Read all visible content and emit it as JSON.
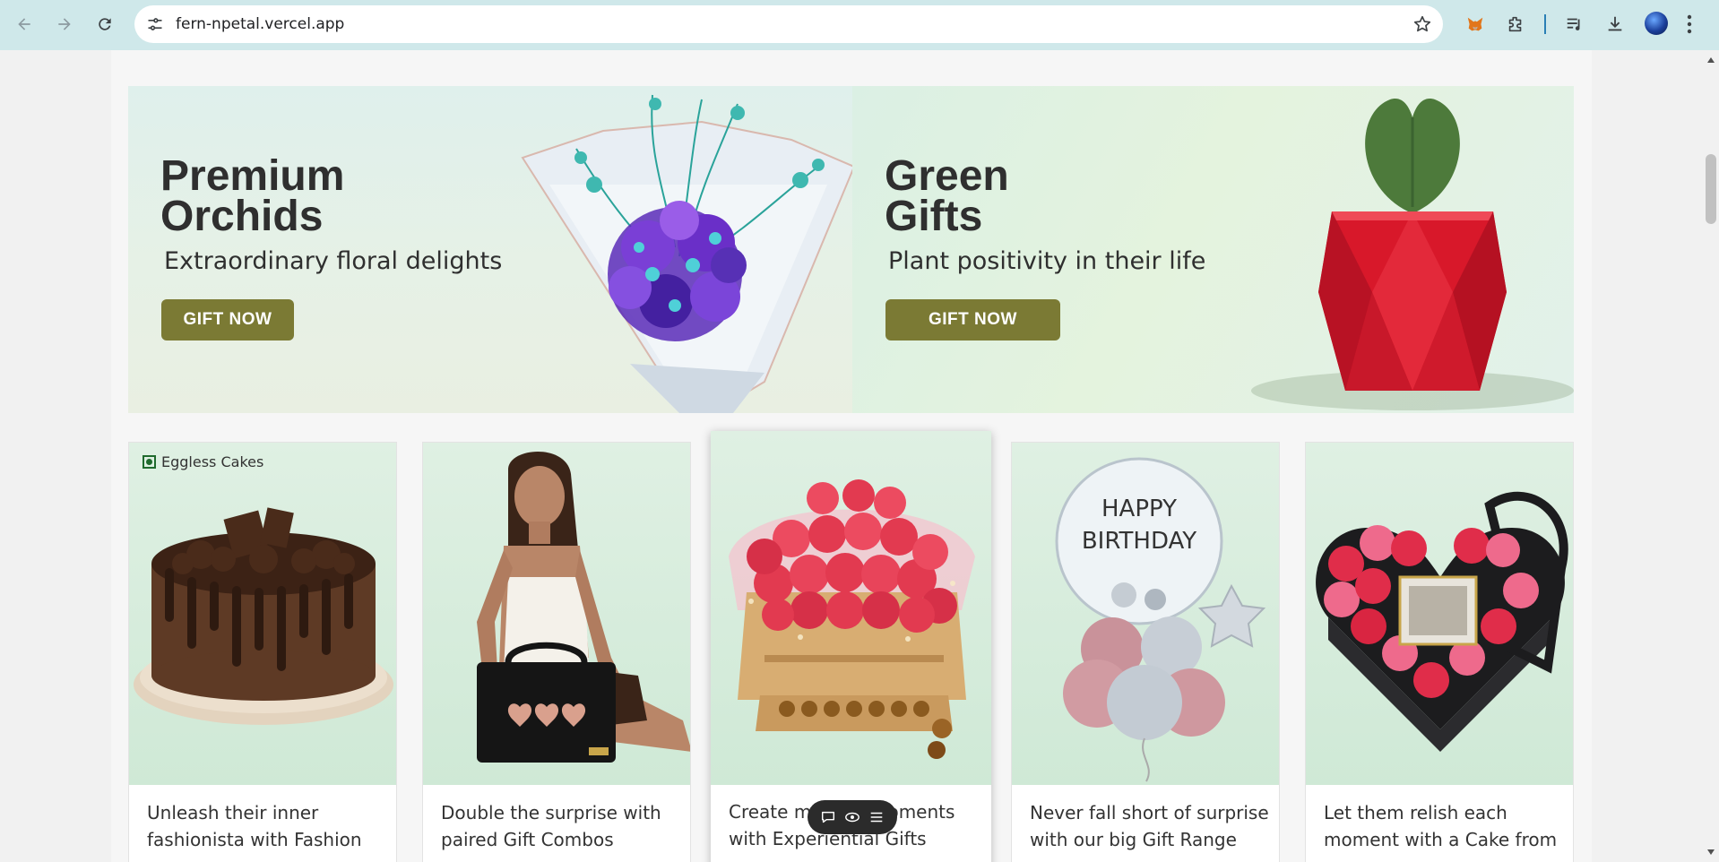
{
  "browser": {
    "url": "fern-npetal.vercel.app",
    "back_icon": "arrow-left-icon",
    "forward_icon": "arrow-right-icon",
    "reload_icon": "reload-icon"
  },
  "banners": [
    {
      "title": "Premium\nOrchids",
      "subtitle": "Extraordinary floral delights",
      "button": "GIFT NOW"
    },
    {
      "title": "Green\nGifts",
      "subtitle": "Plant positivity in their life",
      "button": "GIFT NOW"
    }
  ],
  "cards": [
    {
      "badge": "Eggless Cakes",
      "caption": "Unleash their inner fashionista with Fashion"
    },
    {
      "caption": "Double the surprise with paired Gift Combos"
    },
    {
      "caption": "Create magical moments with Experiential Gifts"
    },
    {
      "caption": "Never fall short of surprise with our big Gift Range"
    },
    {
      "caption": "Let them relish each moment with a Cake from you"
    }
  ],
  "balloon_text": "HAPPY BIRTHDAY",
  "colors": {
    "gift_button": "#7b7a34",
    "chrome": "#cfe8ea"
  }
}
